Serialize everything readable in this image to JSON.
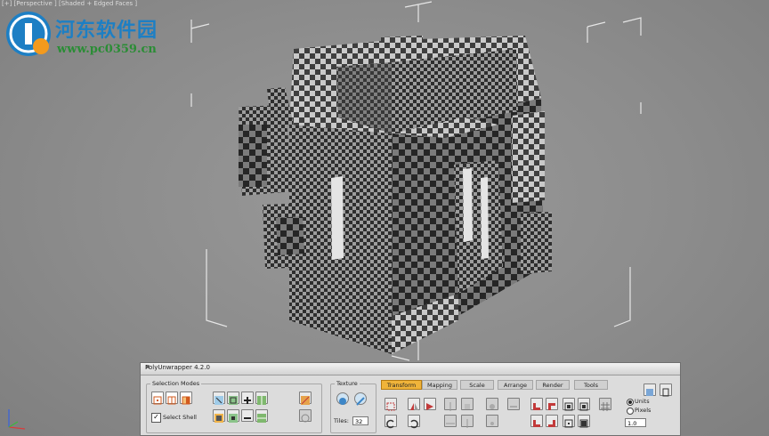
{
  "viewport": {
    "label": "[+] [Perspective ] [Shaded + Edged Faces ]"
  },
  "watermark": {
    "title": "河东软件园",
    "url": "www.pc0359.cn"
  },
  "panel": {
    "title": "PolyUnwrapper 4.2.0",
    "close_icon": "close-icon",
    "selection_modes": {
      "label": "Selection Modes",
      "select_shell_label": "Select Shell",
      "select_shell_checked": true
    },
    "texture": {
      "label": "Texture",
      "tiles_label": "Tiles:",
      "tiles_value": "32"
    },
    "tabs": [
      {
        "label": "Transform",
        "active": true
      },
      {
        "label": "Mapping",
        "active": false
      },
      {
        "label": "Scale",
        "active": false
      },
      {
        "label": "Arrange",
        "active": false
      },
      {
        "label": "Render",
        "active": false
      },
      {
        "label": "Tools",
        "active": false
      }
    ],
    "units": {
      "units_label": "Units",
      "pixels_label": "Pixels",
      "selected": "Units",
      "value": "1.0"
    }
  },
  "colors": {
    "active_tab": "#f0b43a",
    "panel_bg": "#dcdcdc",
    "viewport_bg": "#8c8c8c",
    "watermark_blue": "#1d7fc4",
    "watermark_green": "#2a8d35"
  }
}
